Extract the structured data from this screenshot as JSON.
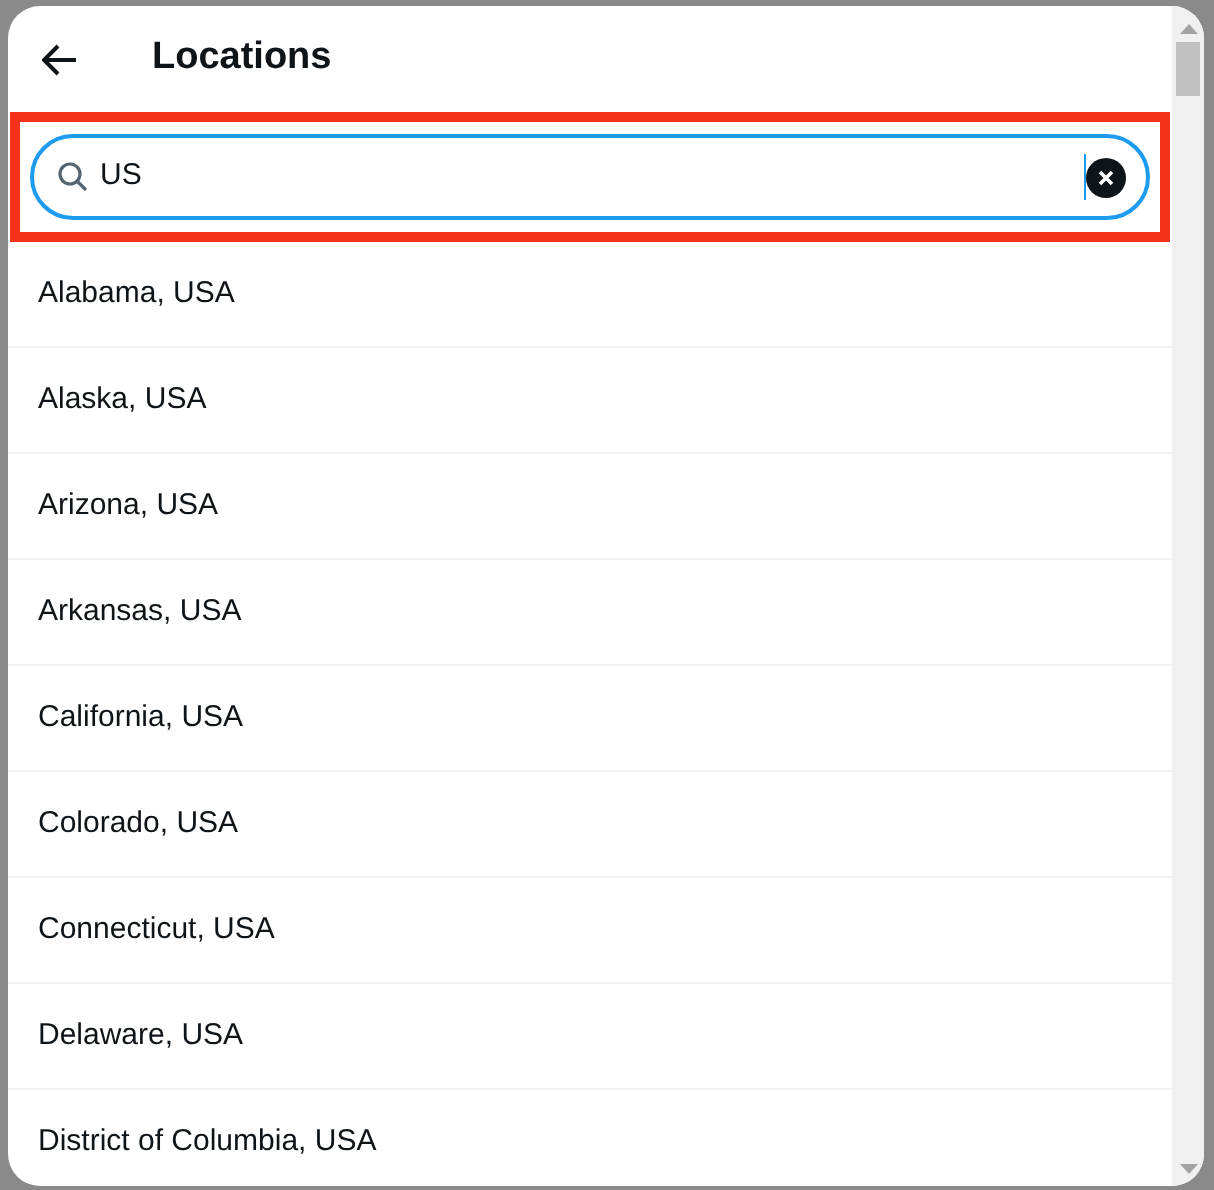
{
  "dialog": {
    "title": "Locations"
  },
  "search": {
    "value": "US",
    "focused": true,
    "highlighted": true
  },
  "results": [
    {
      "label": "Alabama, USA"
    },
    {
      "label": "Alaska, USA"
    },
    {
      "label": "Arizona, USA"
    },
    {
      "label": "Arkansas, USA"
    },
    {
      "label": "California, USA"
    },
    {
      "label": "Colorado, USA"
    },
    {
      "label": "Connecticut, USA"
    },
    {
      "label": "Delaware, USA"
    },
    {
      "label": "District of Columbia, USA"
    }
  ]
}
